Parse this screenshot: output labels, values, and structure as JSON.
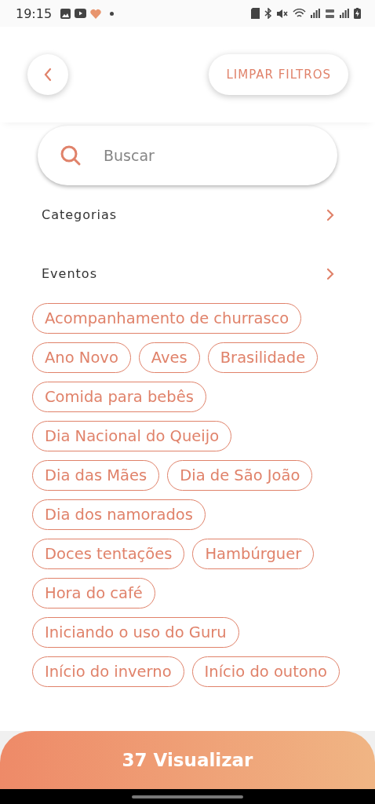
{
  "status_bar": {
    "time": "19:15"
  },
  "header": {
    "clear_button": "LIMPAR FILTROS"
  },
  "search": {
    "placeholder": "Buscar"
  },
  "sections": [
    {
      "label": "Categorias"
    },
    {
      "label": "Eventos"
    }
  ],
  "events": [
    {
      "label": "Acompanhamento de churrasco"
    },
    {
      "label": "Ano Novo"
    },
    {
      "label": "Aves"
    },
    {
      "label": "Brasilidade"
    },
    {
      "label": "Comida para bebês"
    },
    {
      "label": "Dia Nacional do Queijo"
    },
    {
      "label": "Dia das Mães"
    },
    {
      "label": "Dia de São João"
    },
    {
      "label": "Dia dos namorados"
    },
    {
      "label": "Doces tentações"
    },
    {
      "label": "Hambúrguer"
    },
    {
      "label": "Hora do café"
    },
    {
      "label": "Iniciando o uso do Guru"
    },
    {
      "label": "Início do inverno"
    },
    {
      "label": "Início do outono"
    }
  ],
  "view_button": "37 Visualizar"
}
